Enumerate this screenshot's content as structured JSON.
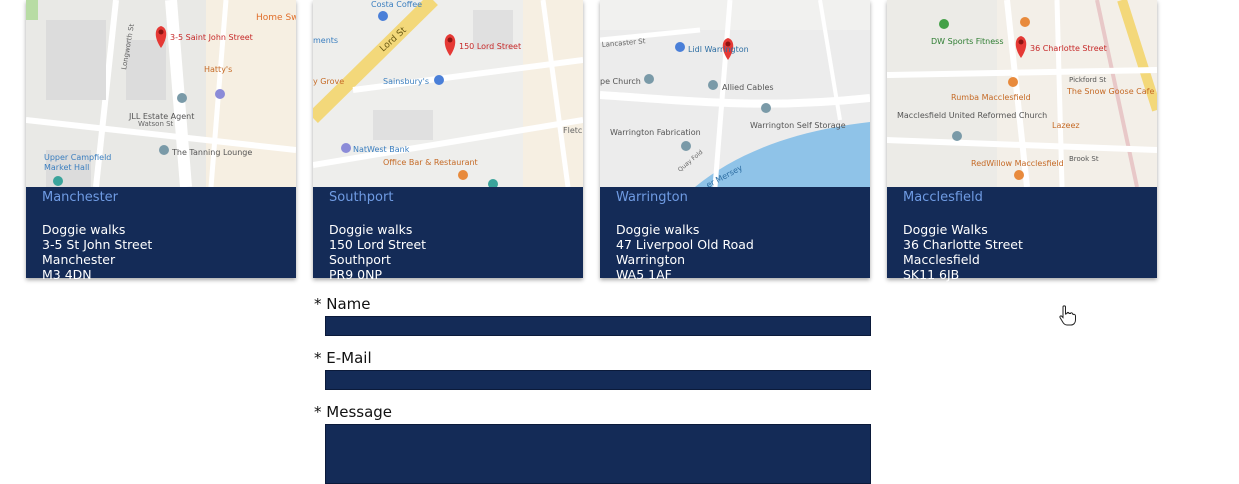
{
  "locations": [
    {
      "city": "Manchester",
      "name": "Doggie walks",
      "street": "3-5 St John Street",
      "town": "Manchester",
      "postcode": "M3 4DN",
      "map_labels": {
        "pin": "3-5 Saint John Street",
        "poi1": "Home Swe",
        "poi2": "Hatty's",
        "poi3": "JLL Estate Agent",
        "poi4": "The Tanning Lounge",
        "poi5": "Upper Campfield",
        "poi6": "Market Hall",
        "street1": "Longworth St",
        "street2": "Watson St"
      }
    },
    {
      "city": "Southport",
      "name": "Doggie walks",
      "street": "150 Lord Street",
      "town": "Southport",
      "postcode": "PR9 0NP",
      "map_labels": {
        "pin": "150 Lord Street",
        "poi1": "Costa Coffee",
        "poi2": "ments",
        "poi3": "y Grove",
        "poi4": "Sainsbury's",
        "poi5": "NatWest Bank",
        "poi6": "Office Bar & Restaurant",
        "street1": "Lord St",
        "street2": "Fletc"
      }
    },
    {
      "city": "Warrington",
      "name": "Doggie walks",
      "street": "47 Liverpool Old Road",
      "town": "Warrington",
      "postcode": "WA5 1AF",
      "map_labels": {
        "pin": "Lidl Warrington",
        "poi1": "pe Church",
        "poi2": "Allied Cables",
        "poi3": "Warrington Fabrication",
        "poi4": "Warrington Self Storage",
        "poi5": "er Mersey",
        "poi6": "Quay Fold",
        "street1": "Lancaster St",
        "street2": ""
      }
    },
    {
      "city": "Macclesfield",
      "name": "Doggie Walks",
      "street": "36 Charlotte Street",
      "town": "Macclesfield",
      "postcode": "SK11 6JB",
      "map_labels": {
        "pin": "36 Charlotte Street",
        "poi1": "DW Sports Fitness",
        "poi2": "Rumba Macclesfield",
        "poi3": "The Snow Goose Cafe Bar",
        "poi4": "Macclesfield United Reformed Church",
        "poi5": "Lazeez",
        "poi6": "RedWillow Macclesfield",
        "street1": "Pickford St",
        "street2": "Brook St"
      }
    }
  ],
  "form": {
    "name_label": "* Name",
    "email_label": "* E-Mail",
    "message_label": "* Message"
  },
  "colors": {
    "card_info_bg": "#142b57",
    "city_text": "#6f9be3",
    "pin": "#e53935"
  }
}
